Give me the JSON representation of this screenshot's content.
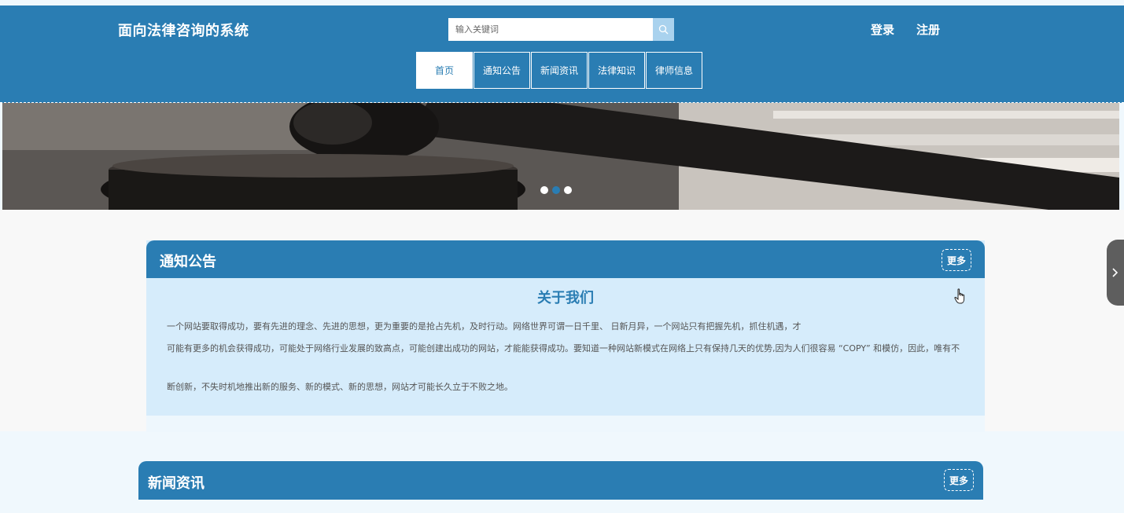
{
  "header": {
    "site_title": "面向法律咨询的系统",
    "search_placeholder": "输入关键词",
    "login": "登录",
    "register": "注册"
  },
  "nav": {
    "items": [
      {
        "label": "首页",
        "active": true
      },
      {
        "label": "通知公告"
      },
      {
        "label": "新闻资讯"
      },
      {
        "label": "法律知识"
      },
      {
        "label": "律师信息"
      }
    ]
  },
  "notice": {
    "title": "通知公告",
    "more": "更多",
    "article_title": "关于我们",
    "paragraphs": [
      "一个网站要取得成功，要有先进的理念、先进的思想，更为重要的是抢占先机，及时行动。网络世界可谓一日千里、 日新月异，一个网站只有把握先机，抓住机遇，才",
      "可能有更多的机会获得成功，可能处于网络行业发展的致高点，可能创建出成功的网站，才能能获得成功。要知道一种网站新模式在网络上只有保持几天的优势,因为人们很容易 “COPY” 和模仿，因此，唯有不",
      "断创新，不失时机地推出新的服务、新的模式、新的思想，网站才可能长久立于不败之地。"
    ]
  },
  "news": {
    "title": "新闻资讯",
    "more": "更多"
  },
  "colors": {
    "primary": "#2a7db3",
    "panel_bg": "#d6ecfb"
  }
}
